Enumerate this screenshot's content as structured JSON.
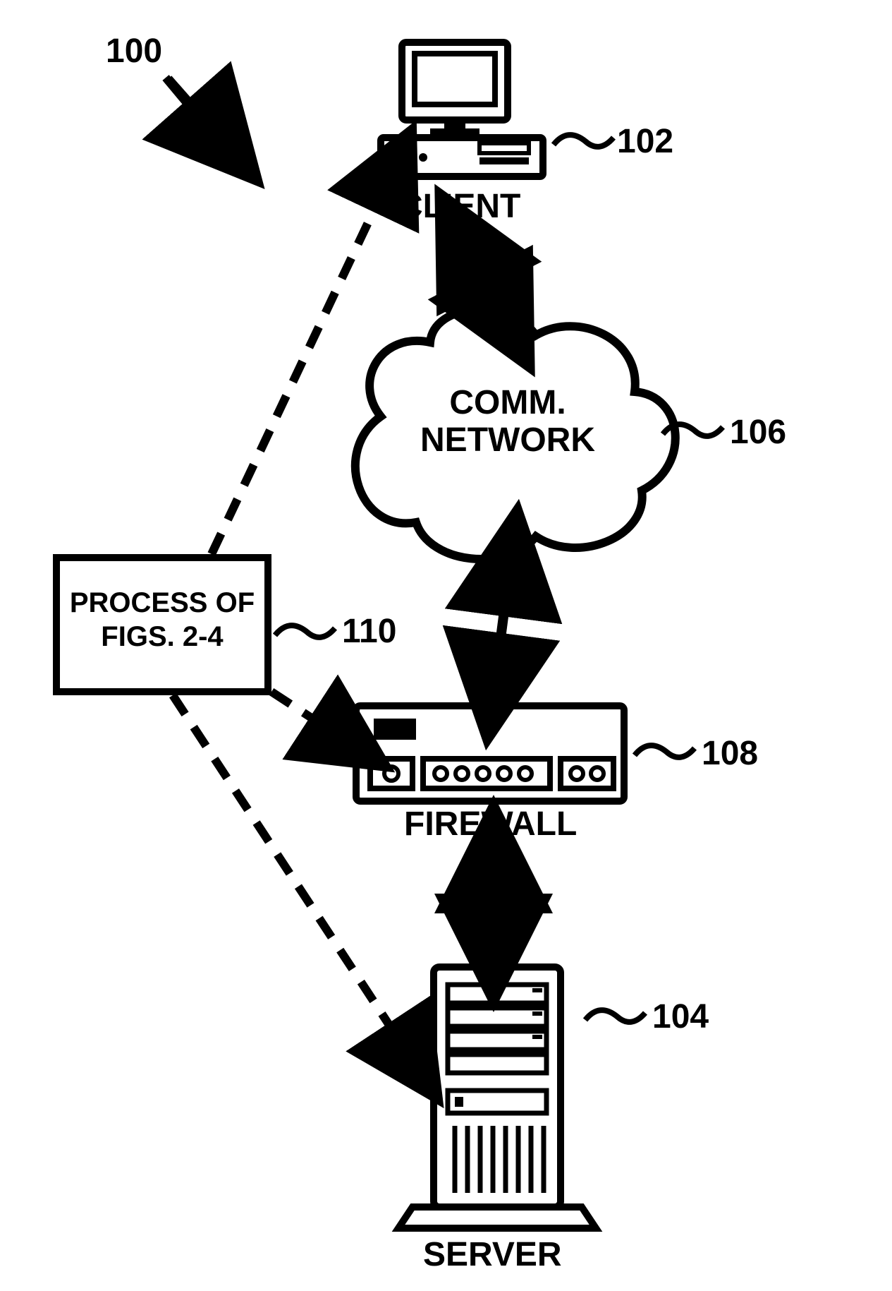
{
  "refs": {
    "fig": "100",
    "client": "102",
    "server": "104",
    "network": "106",
    "firewall": "108",
    "process": "110"
  },
  "labels": {
    "client": "CLIENT",
    "server": "SERVER",
    "firewall": "FIREWALL",
    "network_l1": "COMM.",
    "network_l2": "NETWORK",
    "process_l1": "PROCESS OF",
    "process_l2": "FIGS. 2-4"
  }
}
